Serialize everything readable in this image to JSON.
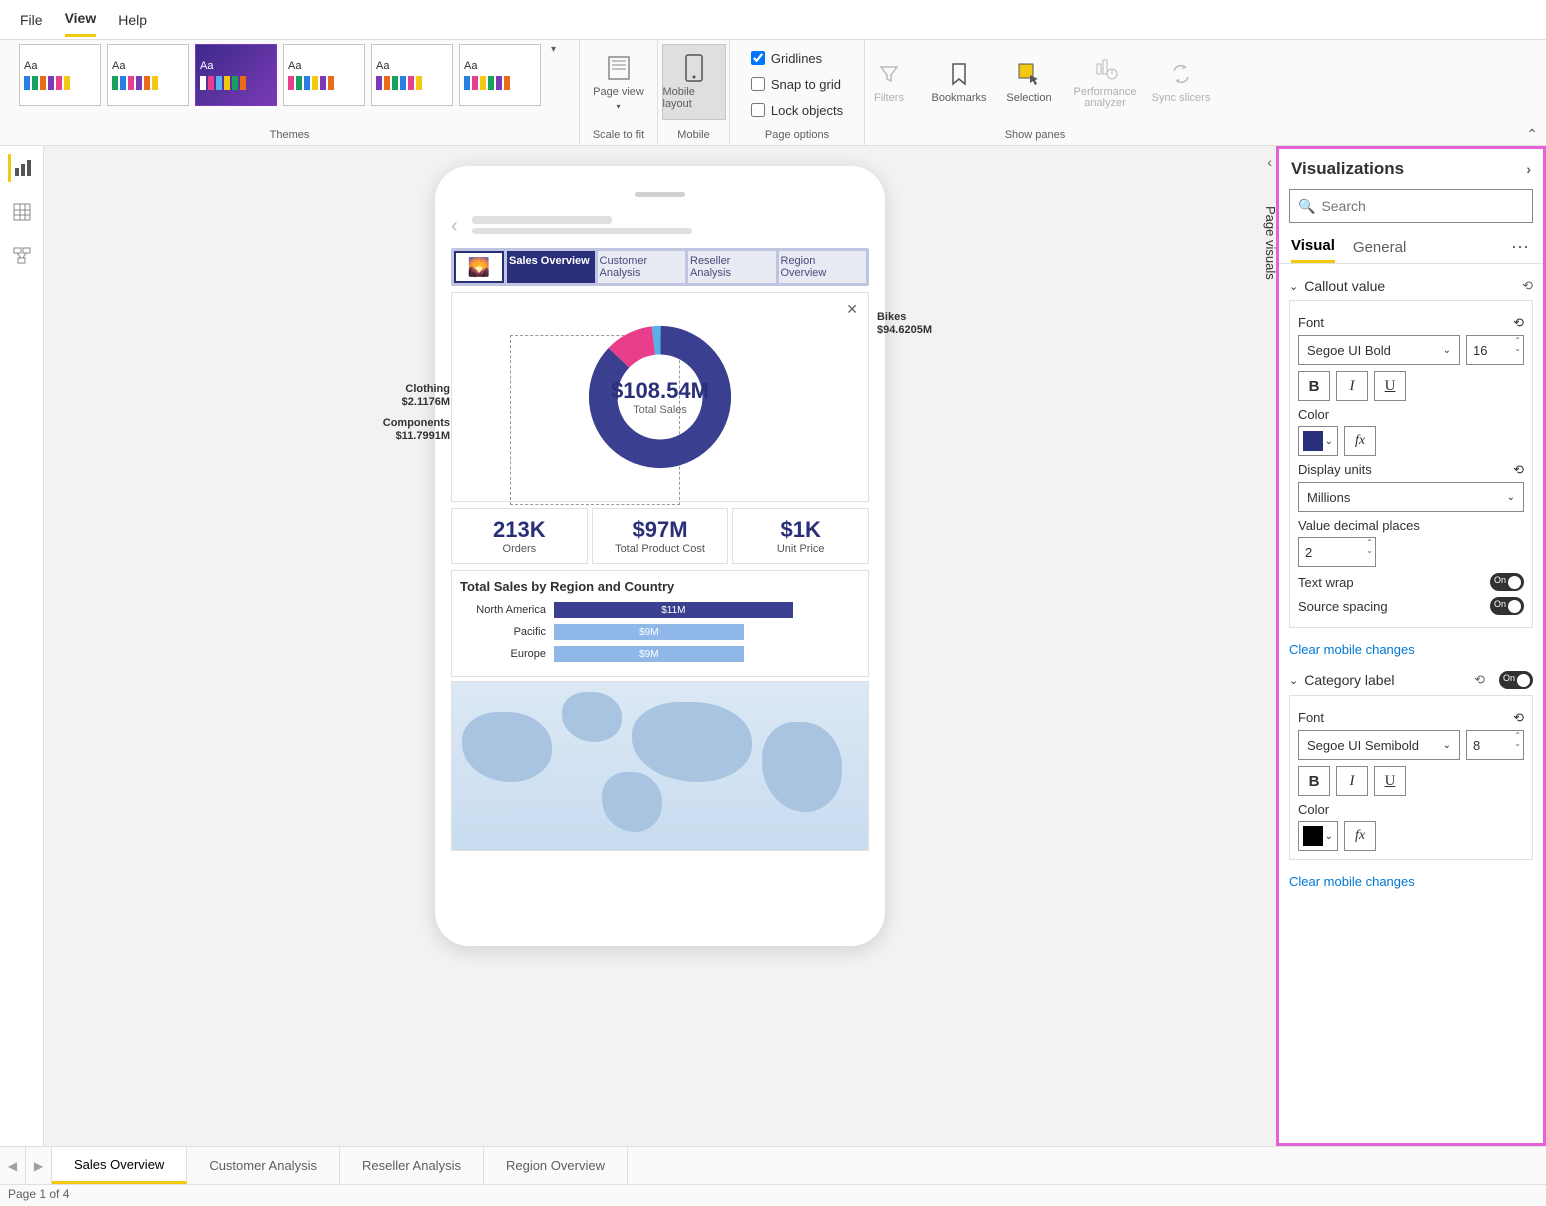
{
  "menu": {
    "file": "File",
    "view": "View",
    "help": "Help"
  },
  "ribbon": {
    "themes_label": "Themes",
    "theme_prefix": "Aa",
    "scale_to_fit_label": "Scale to fit",
    "page_view": "Page view",
    "mobile_label": "Mobile",
    "mobile_layout": "Mobile layout",
    "page_options_label": "Page options",
    "gridlines": "Gridlines",
    "snap_to_grid": "Snap to grid",
    "lock_objects": "Lock objects",
    "show_panes_label": "Show panes",
    "filters": "Filters",
    "bookmarks": "Bookmarks",
    "selection": "Selection",
    "performance": "Performance analyzer",
    "sync_slicers": "Sync slicers"
  },
  "collapsed_pane": "Page visuals",
  "mobile": {
    "tabs": [
      "Sales Overview",
      "Customer Analysis",
      "Reseller Analysis",
      "Region Overview"
    ],
    "donut": {
      "center_value": "$108.54M",
      "center_label": "Total Sales",
      "bikes": "Bikes",
      "bikes_val": "$94.6205M",
      "clothing": "Clothing",
      "clothing_val": "$2.1176M",
      "components": "Components",
      "components_val": "$11.7991M"
    },
    "kpis": [
      {
        "v": "213K",
        "l": "Orders"
      },
      {
        "v": "$97M",
        "l": "Total Product Cost"
      },
      {
        "v": "$1K",
        "l": "Unit Price"
      }
    ],
    "bars": {
      "title": "Total Sales by Region and Country",
      "rows": [
        {
          "label": "North America",
          "value": "$11M"
        },
        {
          "label": "Pacific",
          "value": "$9M"
        },
        {
          "label": "Europe",
          "value": "$9M"
        }
      ]
    }
  },
  "viz": {
    "title": "Visualizations",
    "search_ph": "Search",
    "tab_visual": "Visual",
    "tab_general": "General",
    "callout_value": "Callout value",
    "font": "Font",
    "font1_family": "Segoe UI Bold",
    "font1_size": "16",
    "color": "Color",
    "color1": "#2a2f7a",
    "display_units": "Display units",
    "display_units_val": "Millions",
    "decimal_places": "Value decimal places",
    "decimal_val": "2",
    "text_wrap": "Text wrap",
    "source_spacing": "Source spacing",
    "on": "On",
    "clear": "Clear mobile changes",
    "category_label": "Category label",
    "font2_family": "Segoe UI Semibold",
    "font2_size": "8",
    "color2": "#000000"
  },
  "pages": {
    "tabs": [
      "Sales Overview",
      "Customer Analysis",
      "Reseller Analysis",
      "Region Overview"
    ],
    "status": "Page 1 of 4"
  },
  "chart_data": [
    {
      "type": "pie",
      "title": "Total Sales",
      "center_value": 108.54,
      "unit": "$M",
      "slices": [
        {
          "name": "Bikes",
          "value": 94.6205,
          "color": "#3a3f8f"
        },
        {
          "name": "Components",
          "value": 11.7991,
          "color": "#e83e8c"
        },
        {
          "name": "Clothing",
          "value": 2.1176,
          "color": "#5ab0e8"
        }
      ]
    },
    {
      "type": "bar",
      "title": "Total Sales by Region and Country",
      "orientation": "horizontal",
      "categories": [
        "North America",
        "Pacific",
        "Europe"
      ],
      "values": [
        11,
        9,
        9
      ],
      "unit": "$M",
      "colors": [
        "#3a3f8f",
        "#8fb8e8",
        "#8fb8e8"
      ],
      "xlim": [
        0,
        12
      ]
    }
  ]
}
